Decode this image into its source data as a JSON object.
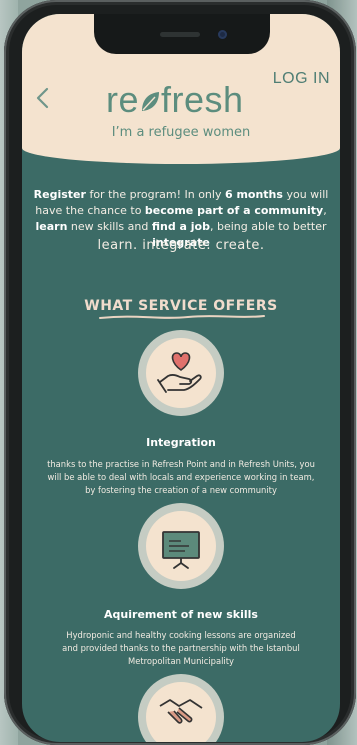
{
  "header": {
    "back_icon": "chevron-left-icon",
    "login_label": "LOG IN",
    "logo_part1": "re",
    "logo_part2": "fresh",
    "logo_leaf_icon": "leaf-icon",
    "tagline": "I’m a refugee women"
  },
  "intro": {
    "t1": "Register",
    "t2": " for the program! In only ",
    "t3": "6 months",
    "t4": " you will have the chance to ",
    "t5": "become part of a community",
    "t6": ", ",
    "t7": "learn",
    "t8": " new skills and ",
    "t9": "find a job",
    "t10": ", being able to better ",
    "t11": "integrate",
    "motto": "learn. integrate. create."
  },
  "services": {
    "title": "WHAT SERVICE OFFERS",
    "items": [
      {
        "icon": "heart-hand-icon",
        "title": "Integration",
        "desc_line1": "thanks to the practise in Refresh Point and in Refresh Units, you",
        "desc_line2": "will be able to deal with locals and experience working in team,",
        "desc_line3": "by fostering the creation of a new community"
      },
      {
        "icon": "presentation-board-icon",
        "title": "Aquirement of new skills",
        "desc_line1": "Hydroponic and healthy cooking lessons are organized",
        "desc_line2": "and provided thanks to the partnership with the Istanbul",
        "desc_line3": "Metropolitan Municipality"
      },
      {
        "icon": "handshake-icon"
      }
    ]
  },
  "colors": {
    "teal_background": "#3c6b66",
    "cream_header": "#f4e3cf",
    "logo_green": "#5c8d7e",
    "heart_red": "#e0716c"
  }
}
